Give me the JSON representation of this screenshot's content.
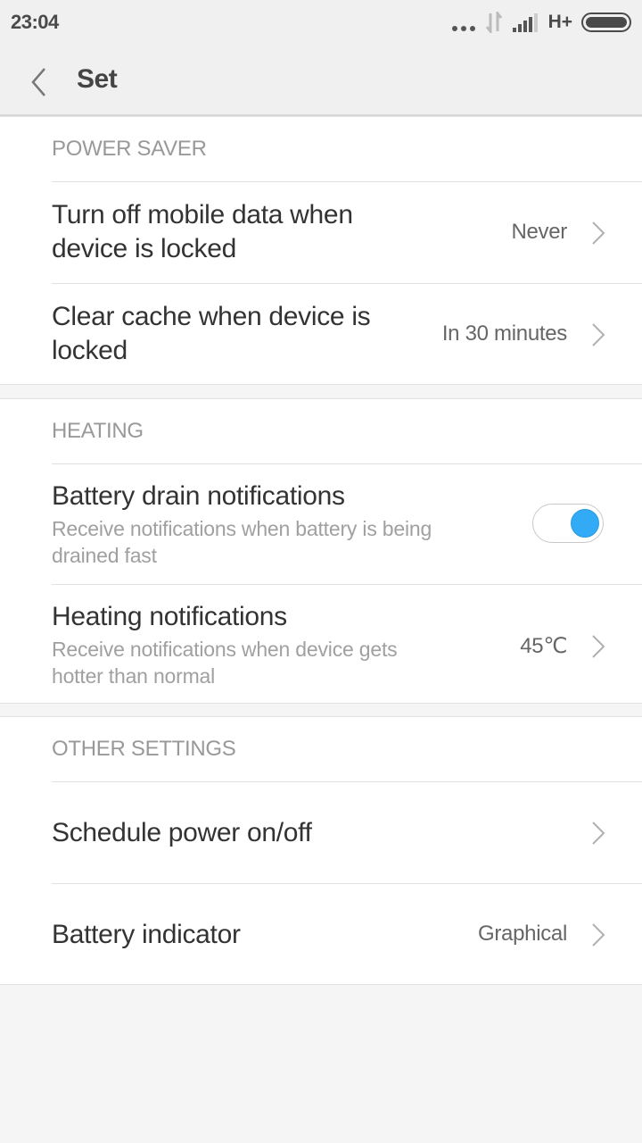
{
  "status_bar": {
    "time": "23:04",
    "network_type": "H+",
    "icons": [
      "more-dots-icon",
      "data-transfer-icon",
      "signal-icon",
      "battery-icon"
    ]
  },
  "header": {
    "back_icon": "chevron-left-icon",
    "title": "Set"
  },
  "sections": [
    {
      "header": "POWER SAVER",
      "rows": [
        {
          "title_lines": [
            "Turn off mobile data when",
            "device is locked"
          ],
          "value": "Never",
          "type": "chevron"
        },
        {
          "title_lines": [
            "Clear cache when device is",
            "locked"
          ],
          "value": "In 30 minutes",
          "type": "chevron"
        }
      ]
    },
    {
      "header": "HEATING",
      "rows": [
        {
          "title": "Battery drain notifications",
          "subtitle_lines": [
            "Receive notifications when battery is being",
            "drained fast"
          ],
          "type": "toggle",
          "enabled": true
        },
        {
          "title": "Heating notifications",
          "subtitle_lines": [
            "Receive notifications when device gets",
            "hotter than normal"
          ],
          "value": "45℃",
          "type": "chevron"
        }
      ]
    },
    {
      "header": "OTHER SETTINGS",
      "rows": [
        {
          "title": "Schedule power on/off",
          "type": "chevron"
        },
        {
          "title": "Battery indicator",
          "value": "Graphical",
          "type": "chevron"
        }
      ]
    }
  ],
  "colors": {
    "accent": "#33aaf5",
    "background": "#f5f5f5",
    "header_bg": "#f0f0f0",
    "section_label": "#999999",
    "primary_text": "#333333",
    "secondary_text": "#a0a0a0"
  }
}
